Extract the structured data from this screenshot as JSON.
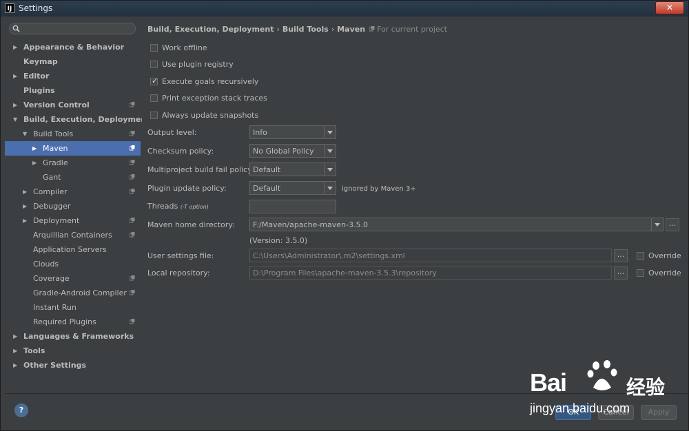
{
  "window": {
    "title": "Settings",
    "app_icon": "IJ"
  },
  "search": {
    "placeholder": "",
    "icon": "search-icon"
  },
  "tree": [
    {
      "label": "Appearance & Behavior",
      "bold": true,
      "arrow": "▶",
      "indent": 0
    },
    {
      "label": "Keymap",
      "bold": true,
      "arrow": "",
      "indent": 0
    },
    {
      "label": "Editor",
      "bold": true,
      "arrow": "▶",
      "indent": 0
    },
    {
      "label": "Plugins",
      "bold": true,
      "arrow": "",
      "indent": 0
    },
    {
      "label": "Version Control",
      "bold": true,
      "arrow": "▶",
      "indent": 0,
      "copy": true
    },
    {
      "label": "Build, Execution, Deployment",
      "bold": true,
      "arrow": "▼",
      "indent": 0
    },
    {
      "label": "Build Tools",
      "bold": false,
      "arrow": "▼",
      "indent": 1,
      "copy": true
    },
    {
      "label": "Maven",
      "bold": false,
      "arrow": "▶",
      "indent": 2,
      "copy": true,
      "selected": true
    },
    {
      "label": "Gradle",
      "bold": false,
      "arrow": "▶",
      "indent": 2,
      "copy": true
    },
    {
      "label": "Gant",
      "bold": false,
      "arrow": "",
      "indent": 2,
      "copy": true
    },
    {
      "label": "Compiler",
      "bold": false,
      "arrow": "▶",
      "indent": 1,
      "copy": true
    },
    {
      "label": "Debugger",
      "bold": false,
      "arrow": "▶",
      "indent": 1
    },
    {
      "label": "Deployment",
      "bold": false,
      "arrow": "▶",
      "indent": 1,
      "copy": true
    },
    {
      "label": "Arquillian Containers",
      "bold": false,
      "arrow": "",
      "indent": 1,
      "copy": true
    },
    {
      "label": "Application Servers",
      "bold": false,
      "arrow": "",
      "indent": 1
    },
    {
      "label": "Clouds",
      "bold": false,
      "arrow": "",
      "indent": 1
    },
    {
      "label": "Coverage",
      "bold": false,
      "arrow": "",
      "indent": 1,
      "copy": true
    },
    {
      "label": "Gradle-Android Compiler",
      "bold": false,
      "arrow": "",
      "indent": 1,
      "copy": true
    },
    {
      "label": "Instant Run",
      "bold": false,
      "arrow": "",
      "indent": 1
    },
    {
      "label": "Required Plugins",
      "bold": false,
      "arrow": "",
      "indent": 1,
      "copy": true
    },
    {
      "label": "Languages & Frameworks",
      "bold": true,
      "arrow": "▶",
      "indent": 0
    },
    {
      "label": "Tools",
      "bold": true,
      "arrow": "▶",
      "indent": 0
    },
    {
      "label": "Other Settings",
      "bold": true,
      "arrow": "▶",
      "indent": 0
    }
  ],
  "breadcrumb": {
    "part1": "Build, Execution, Deployment",
    "sep": "›",
    "part2": "Build Tools",
    "part3": "Maven",
    "project_note": "For current project"
  },
  "checkboxes": [
    {
      "label": "Work offline",
      "checked": false
    },
    {
      "label": "Use plugin registry",
      "checked": false
    },
    {
      "label": "Execute goals recursively",
      "checked": true
    },
    {
      "label": "Print exception stack traces",
      "checked": false
    },
    {
      "label": "Always update snapshots",
      "checked": false
    }
  ],
  "fields": {
    "output_level": {
      "label": "Output level:",
      "value": "Info"
    },
    "checksum_policy": {
      "label": "Checksum policy:",
      "value": "No Global Policy"
    },
    "multiproject_fail": {
      "label": "Multiproject build fail policy:",
      "value": "Default"
    },
    "plugin_update": {
      "label": "Plugin update policy:",
      "value": "Default",
      "hint": "ignored by Maven 3+"
    },
    "threads": {
      "label": "Threads",
      "hint": "(-T option)",
      "value": ""
    },
    "maven_home": {
      "label": "Maven home directory:",
      "value": "F:/Maven/apache-maven-3.5.0",
      "version": "(Version: 3.5.0)"
    },
    "user_settings": {
      "label": "User settings file:",
      "value": "C:\\Users\\Administrator\\.m2\\settings.xml",
      "override": "Override"
    },
    "local_repo": {
      "label": "Local repository:",
      "value": "D:\\Program Files\\apache-maven-3.5.3\\repository",
      "override": "Override"
    }
  },
  "footer": {
    "help": "?",
    "ok": "OK",
    "cancel": "Cancel",
    "apply": "Apply"
  },
  "watermark": {
    "brand": "Bai",
    "brand2": "经验",
    "url": "jingyan.baidu.com"
  },
  "colors": {
    "selection": "#4b6eaf",
    "background": "#3c3f41",
    "default_button": "#365880"
  }
}
